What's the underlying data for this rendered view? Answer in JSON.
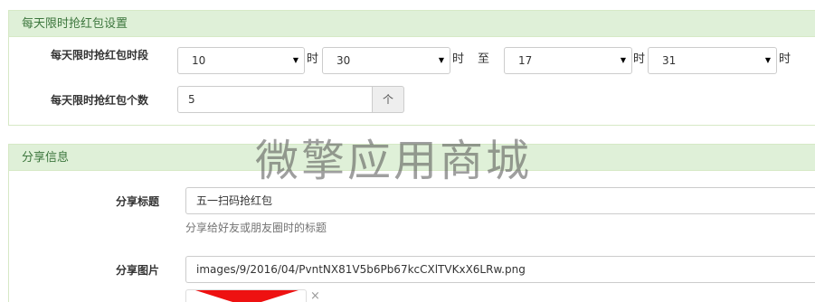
{
  "limit_panel": {
    "title": "每天限时抢红包设置",
    "time_label": "每天限时抢红包时段",
    "start_hour": "10",
    "start_minute": "30",
    "end_hour": "17",
    "end_minute": "31",
    "hour_unit": "时",
    "to_label": "至",
    "count_label": "每天限时抢红包个数",
    "count_value": "5",
    "count_unit": "个"
  },
  "watermark": "微擎应用商城",
  "share_panel": {
    "title": "分享信息",
    "share_title_label": "分享标题",
    "share_title_value": "五一扫码抢红包",
    "share_title_help": "分享给好友或朋友圈时的标题",
    "share_image_label": "分享图片",
    "share_image_value": "images/9/2016/04/PvntNX81V5b6Pb67kcCXlTVKxX6LRw.png",
    "remove_glyph": "×"
  },
  "icons": {
    "dropdown": "caret-down-icon",
    "remove": "close-icon"
  },
  "colors": {
    "panel_head_bg": "#dff0d8",
    "panel_head_text": "#3c763d",
    "panel_border": "#d6e9c6"
  }
}
